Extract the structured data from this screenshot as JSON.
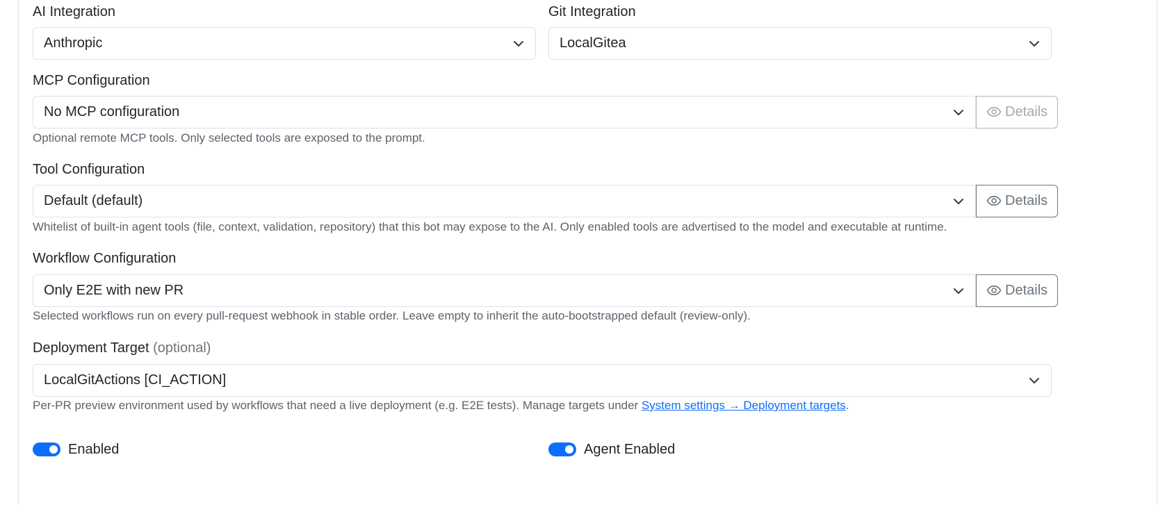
{
  "ai_integration": {
    "label": "AI Integration",
    "selected": "Anthropic"
  },
  "git_integration": {
    "label": "Git Integration",
    "selected": "LocalGitea"
  },
  "mcp_configuration": {
    "label": "MCP Configuration",
    "selected": "No MCP configuration",
    "details_label": "Details",
    "help": "Optional remote MCP tools. Only selected tools are exposed to the prompt."
  },
  "tool_configuration": {
    "label": "Tool Configuration",
    "selected": "Default (default)",
    "details_label": "Details",
    "help": "Whitelist of built-in agent tools (file, context, validation, repository) that this bot may expose to the AI. Only enabled tools are advertised to the model and executable at runtime."
  },
  "workflow_configuration": {
    "label": "Workflow Configuration",
    "selected": "Only E2E with new PR",
    "details_label": "Details",
    "help": "Selected workflows run on every pull-request webhook in stable order. Leave empty to inherit the auto-bootstrapped default (review-only)."
  },
  "deployment_target": {
    "label": "Deployment Target",
    "label_suffix": "(optional)",
    "selected": "LocalGitActions [CI_ACTION]",
    "help_prefix": "Per-PR preview environment used by workflows that need a live deployment (e.g. E2E tests). Manage targets under ",
    "help_link": "System settings → Deployment targets",
    "help_suffix": "."
  },
  "toggles": {
    "enabled_label": "Enabled",
    "enabled_on": true,
    "agent_enabled_label": "Agent Enabled",
    "agent_enabled_on": true
  },
  "colors": {
    "accent": "#0d6efd",
    "border": "#dee2e6",
    "muted_text": "#6c757d"
  },
  "icons": {
    "select_caret": "chevron-down-icon",
    "details": "eye-icon"
  }
}
